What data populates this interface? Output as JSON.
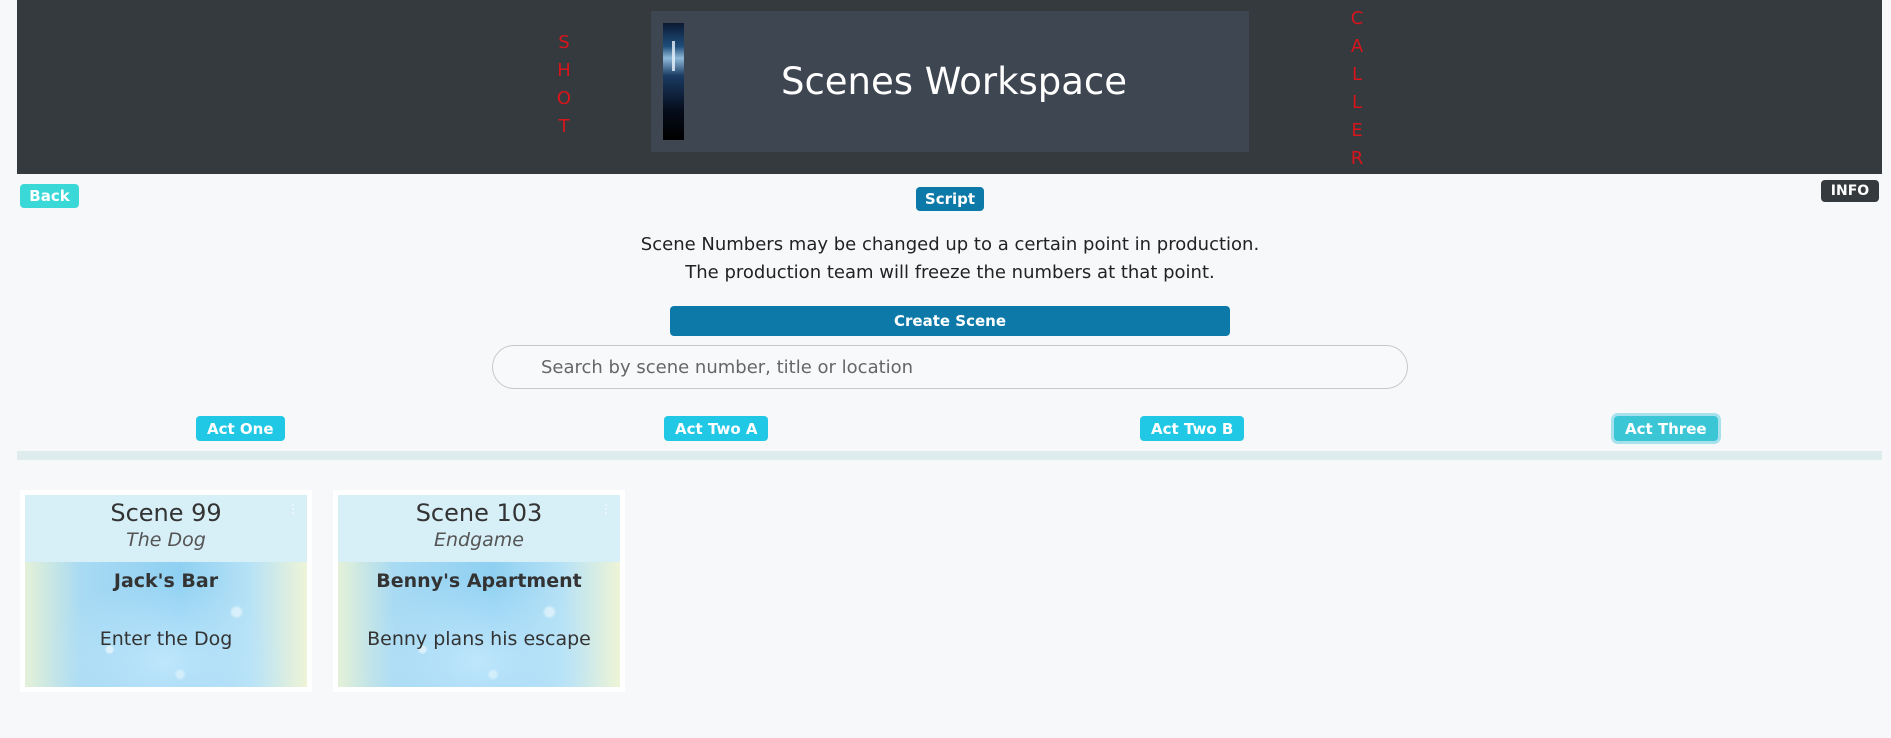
{
  "header": {
    "title": "Scenes Workspace",
    "left_vertical": [
      "S",
      "H",
      "O",
      "T"
    ],
    "right_vertical": [
      "C",
      "A",
      "L",
      "L",
      "E",
      "R"
    ]
  },
  "toolbar": {
    "back_label": "Back",
    "script_label": "Script",
    "info_label": "INFO"
  },
  "notice": {
    "line1": "Scene Numbers may be changed up to a certain point in production.",
    "line2": "The production team will freeze the numbers at that point."
  },
  "actions": {
    "create_label": "Create Scene"
  },
  "search": {
    "placeholder": "Search by scene number, title or location",
    "value": ""
  },
  "tabs": [
    {
      "label": "Act One"
    },
    {
      "label": "Act Two A"
    },
    {
      "label": "Act Two B"
    },
    {
      "label": "Act Three",
      "active": true
    }
  ],
  "scenes": [
    {
      "number": "Scene 99",
      "title": "The Dog",
      "location": "Jack's Bar",
      "description": "Enter the Dog"
    },
    {
      "number": "Scene 103",
      "title": "Endgame",
      "location": "Benny's Apartment",
      "description": "Benny plans his escape"
    }
  ],
  "colors": {
    "header_bg": "#343a3d",
    "accent_red": "#d8141c",
    "primary_blue": "#0c79a8",
    "tab_cyan": "#21c8e6",
    "back_teal": "#3bd8d8"
  }
}
